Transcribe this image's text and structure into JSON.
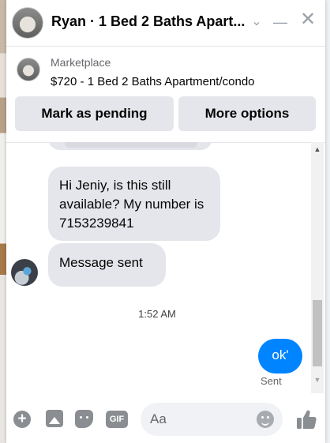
{
  "header": {
    "title": "Ryan · 1 Bed 2 Baths Apart...",
    "icons": [
      "chevron-down-icon",
      "minimize-icon",
      "close-icon"
    ]
  },
  "marketplace": {
    "label": "Marketplace",
    "item": "$720 - 1 Bed 2 Baths Apartment/condo",
    "mark_pending_label": "Mark as pending",
    "more_options_label": "More options"
  },
  "messages": {
    "received_1": "Hi Jeniy, is this still available? My number is 7153239841",
    "received_2": "Message sent",
    "timestamp": "1:52 AM",
    "sent_1": "ok'",
    "sent_status": "Sent"
  },
  "composer": {
    "placeholder": "Aa",
    "icons": [
      "plus-icon",
      "photo-icon",
      "sticker-icon",
      "gif-icon",
      "emoji-icon",
      "like-icon"
    ],
    "gif_label": "GIF"
  },
  "colors": {
    "accent": "#0084ff",
    "bubble_received": "#e4e6eb",
    "button_bg": "#e4e6eb"
  }
}
